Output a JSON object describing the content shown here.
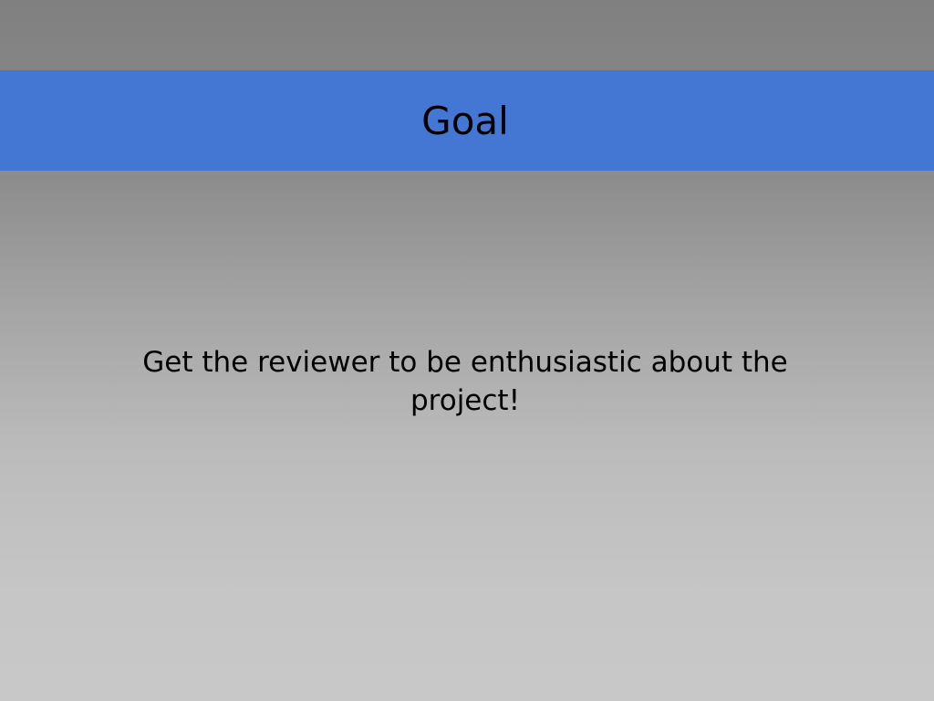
{
  "slide": {
    "title": "Goal",
    "body": "Get the reviewer to be enthusiastic about the project!"
  },
  "colors": {
    "title_band": "#4377d3",
    "background_top": "#808080",
    "background_bottom": "#c8c8c8",
    "text": "#000000"
  }
}
